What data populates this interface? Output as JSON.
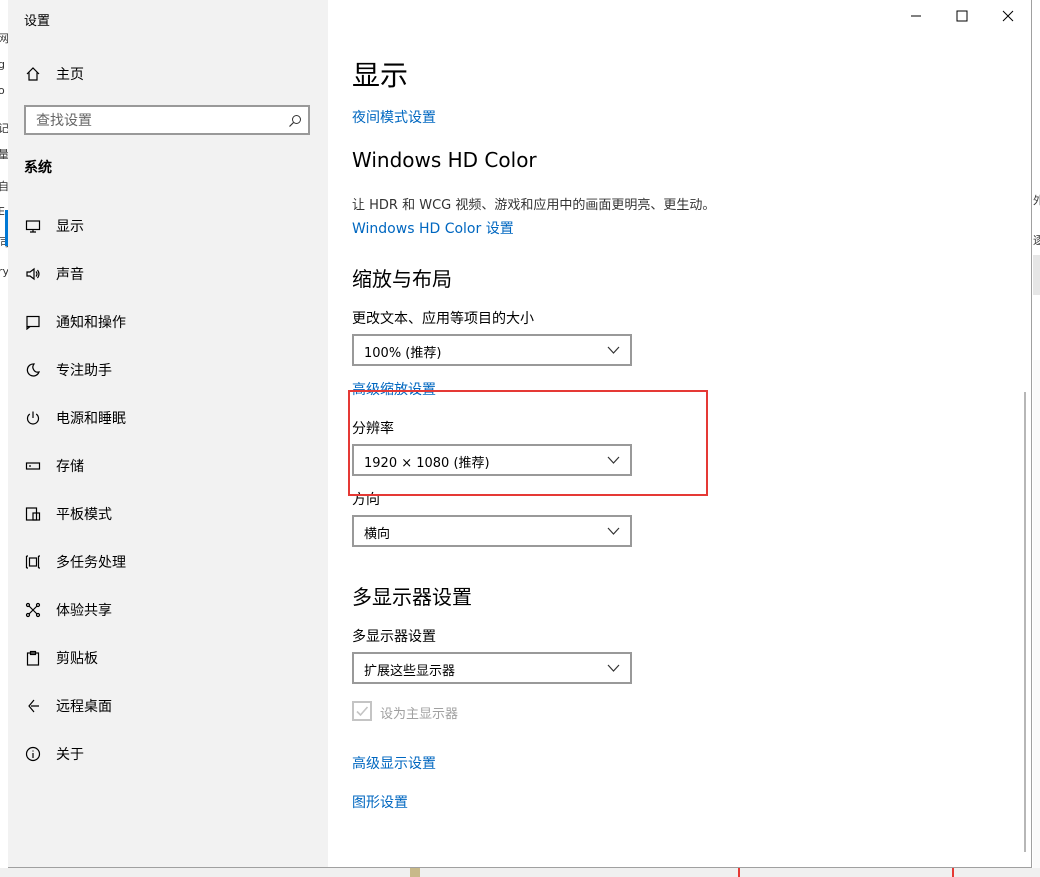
{
  "window": {
    "title": "设置"
  },
  "sidebar": {
    "home_label": "主页",
    "search_placeholder": "查找设置",
    "section": "系统",
    "items": [
      {
        "label": "显示",
        "icon": "monitor-icon"
      },
      {
        "label": "声音",
        "icon": "speaker-icon"
      },
      {
        "label": "通知和操作",
        "icon": "notification-icon"
      },
      {
        "label": "专注助手",
        "icon": "moon-icon"
      },
      {
        "label": "电源和睡眠",
        "icon": "power-icon"
      },
      {
        "label": "存储",
        "icon": "storage-icon"
      },
      {
        "label": "平板模式",
        "icon": "tablet-icon"
      },
      {
        "label": "多任务处理",
        "icon": "multitask-icon"
      },
      {
        "label": "体验共享",
        "icon": "share-icon"
      },
      {
        "label": "剪贴板",
        "icon": "clipboard-icon"
      },
      {
        "label": "远程桌面",
        "icon": "remote-icon"
      },
      {
        "label": "关于",
        "icon": "info-icon"
      }
    ]
  },
  "main": {
    "title": "显示",
    "night_light_link": "夜间模式设置",
    "hdr": {
      "heading": "Windows HD Color",
      "description": "让 HDR 和 WCG 视频、游戏和应用中的画面更明亮、更生动。",
      "link": "Windows HD Color 设置"
    },
    "scale": {
      "heading": "缩放与布局",
      "size_label": "更改文本、应用等项目的大小",
      "size_value": "100% (推荐)",
      "advanced_link": "高级缩放设置",
      "resolution_label": "分辨率",
      "resolution_value": "1920 × 1080 (推荐)",
      "orientation_label": "方向",
      "orientation_value": "横向"
    },
    "multi": {
      "heading": "多显示器设置",
      "label": "多显示器设置",
      "value": "扩展这些显示器",
      "checkbox_label": "设为主显示器",
      "checkbox_checked": true
    },
    "advanced_display_link": "高级显示设置",
    "graphics_link": "图形设置"
  },
  "background": {
    "left_chars": [
      "网",
      "g",
      "o",
      "记",
      "量",
      "自",
      "E",
      "同",
      "ry"
    ],
    "right_chars": [
      "外",
      "逐"
    ]
  }
}
